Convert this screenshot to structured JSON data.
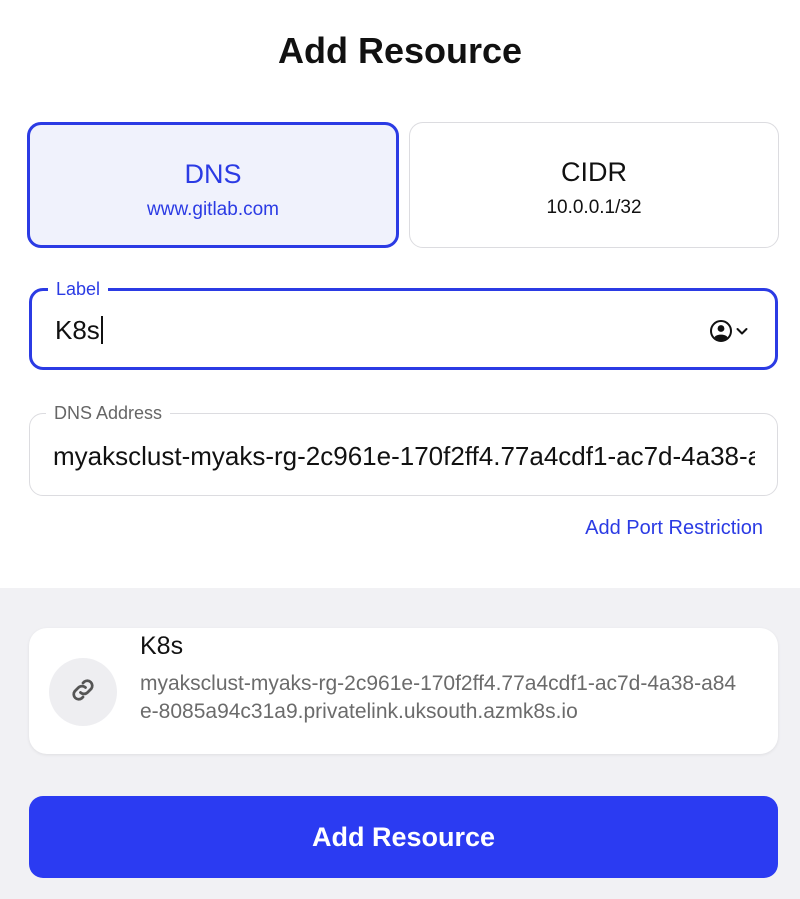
{
  "header": {
    "title": "Add Resource"
  },
  "resource_types": [
    {
      "name": "DNS",
      "example": "www.gitlab.com",
      "selected": true
    },
    {
      "name": "CIDR",
      "example": "10.0.0.1/32",
      "selected": false
    }
  ],
  "label_field": {
    "label": "Label",
    "value": "K8s",
    "icon": "user-circle-icon"
  },
  "dns_field": {
    "label": "DNS Address",
    "value": "myaksclust-myaks-rg-2c961e-170f2ff4.77a4cdf1-ac7d-4a38-a84e-8085a94c31a9.privatelink.uksouth.azmk8s.io"
  },
  "add_port_link": "Add Port Restriction",
  "preview": {
    "name": "K8s",
    "address": "myaksclust-myaks-rg-2c961e-170f2ff4.77a4cdf1-ac7d-4a38-a84e-8085a94c31a9.privatelink.uksouth.azmk8s.io",
    "icon": "link-icon"
  },
  "submit": {
    "label": "Add Resource"
  },
  "colors": {
    "accent": "#2b3be4",
    "button": "#2b3bf2",
    "footer_bg": "#f1f1f4"
  }
}
